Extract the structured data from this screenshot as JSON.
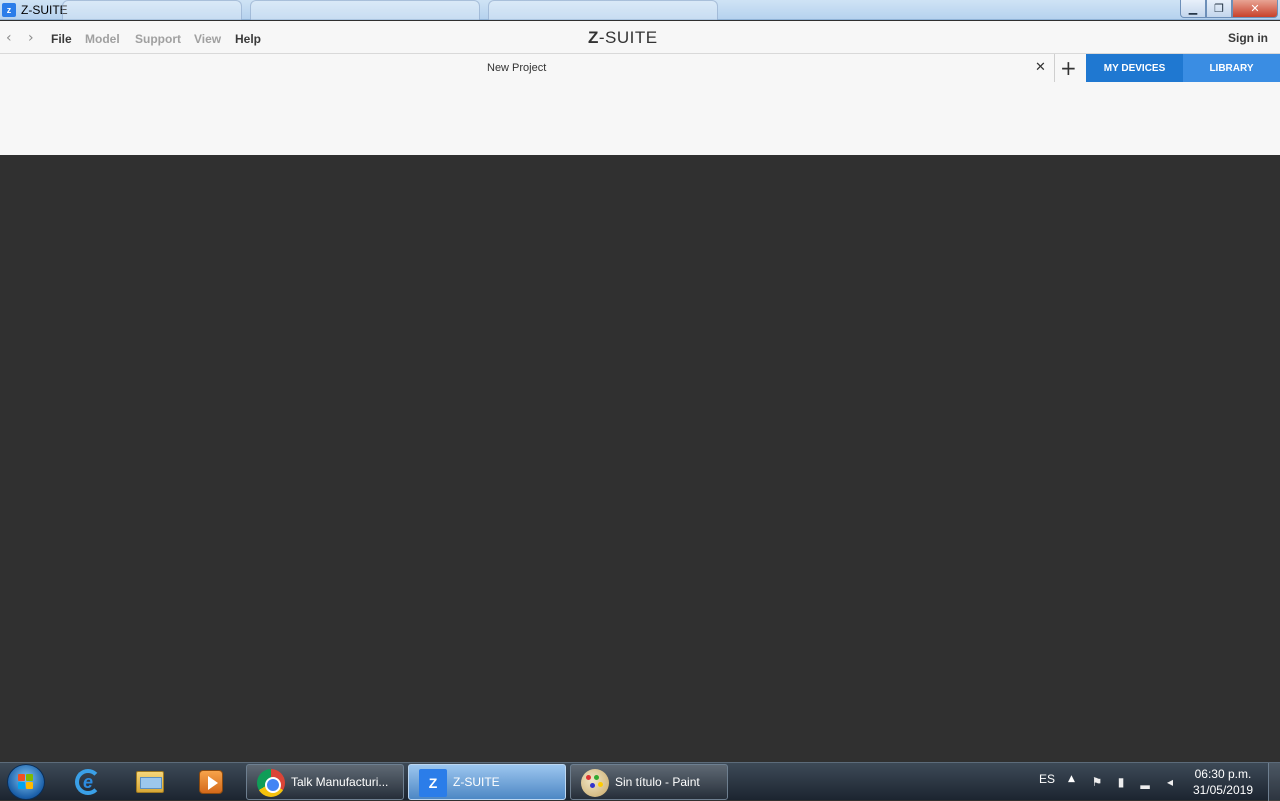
{
  "window": {
    "title": "Z-SUITE",
    "icon_letter": "z",
    "controls": {
      "minimize": "▁",
      "restore": "❐",
      "close": "✕"
    }
  },
  "menubar": {
    "back_glyph": "‹",
    "forward_glyph": "›",
    "items": [
      {
        "label": "File",
        "state": "active"
      },
      {
        "label": "Model",
        "state": "disabled"
      },
      {
        "label": "Support",
        "state": "disabled"
      },
      {
        "label": "View",
        "state": "disabled"
      },
      {
        "label": "Help",
        "state": "active"
      }
    ],
    "brand_bold": "Z",
    "brand_rest": "-SUITE",
    "sign_in": "Sign in"
  },
  "tabs": {
    "project_name": "New Project",
    "close_glyph": "✕",
    "add_glyph": "+",
    "my_devices": "MY DEVICES",
    "library": "LIBRARY"
  },
  "colors": {
    "accent_devices": "#1f78d1",
    "accent_library": "#3a8de3",
    "workspace_bg": "#303030",
    "menubar_bg": "#f7f7f7"
  },
  "taskbar": {
    "pinned": [
      "internet-explorer-icon",
      "file-explorer-icon",
      "media-player-icon"
    ],
    "tasks": [
      {
        "label": "Talk Manufacturi...",
        "icon": "chrome-icon",
        "active": false
      },
      {
        "label": "Z-SUITE",
        "icon": "zsuite-icon",
        "icon_letter": "Z",
        "active": true
      },
      {
        "label": "Sin título - Paint",
        "icon": "paint-icon",
        "active": false
      }
    ],
    "tray": {
      "language": "ES",
      "show_hidden": "▲",
      "time": "06:30 p.m.",
      "date": "31/05/2019"
    }
  }
}
